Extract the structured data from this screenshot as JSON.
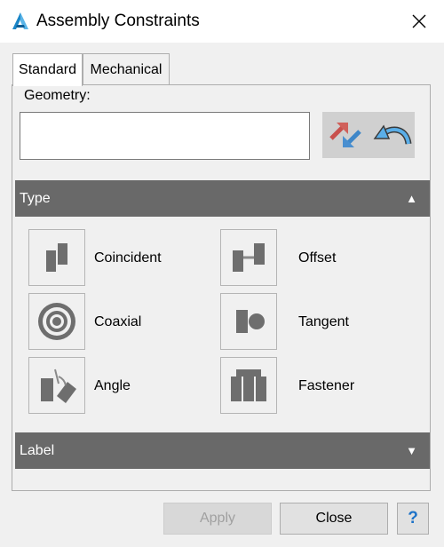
{
  "window": {
    "title": "Assembly Constraints"
  },
  "tabs": [
    {
      "label": "Standard",
      "active": true
    },
    {
      "label": "Mechanical",
      "active": false
    }
  ],
  "geometry": {
    "label": "Geometry:",
    "value": ""
  },
  "sections": {
    "type": {
      "label": "Type",
      "state": "expanded"
    },
    "label": {
      "label": "Label",
      "state": "collapsed"
    }
  },
  "constraint_types": [
    {
      "label": "Coincident",
      "icon": "coincident-icon"
    },
    {
      "label": "Offset",
      "icon": "offset-icon"
    },
    {
      "label": "Coaxial",
      "icon": "coaxial-icon"
    },
    {
      "label": "Tangent",
      "icon": "tangent-icon"
    },
    {
      "label": "Angle",
      "icon": "angle-icon"
    },
    {
      "label": "Fastener",
      "icon": "fastener-icon"
    }
  ],
  "buttons": {
    "apply": {
      "label": "Apply",
      "enabled": false
    },
    "close": {
      "label": "Close"
    },
    "help": {
      "label": "?"
    }
  },
  "colors": {
    "section_bar": "#696969",
    "icon_gray": "#6e6e6e",
    "swap_red": "#d0605a",
    "swap_blue": "#4a8fd0"
  }
}
